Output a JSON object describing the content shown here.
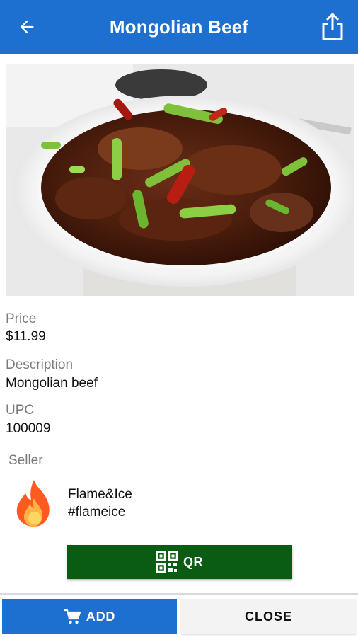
{
  "header": {
    "title": "Mongolian Beef",
    "back_icon": "arrow-left-icon",
    "share_icon": "share-icon",
    "color": "#1d6fd0"
  },
  "product": {
    "image_alt": "Mongolian beef dish",
    "price_label": "Price",
    "price": "$11.99",
    "description_label": "Description",
    "description": "Mongolian beef",
    "upc_label": "UPC",
    "upc": "100009"
  },
  "seller": {
    "label": "Seller",
    "name": "Flame&Ice",
    "handle": "#flameice",
    "logo_icon": "flame-icon"
  },
  "actions": {
    "qr_label": "QR",
    "qr_color": "#0a5c12",
    "add_label": "ADD",
    "close_label": "CLOSE"
  }
}
